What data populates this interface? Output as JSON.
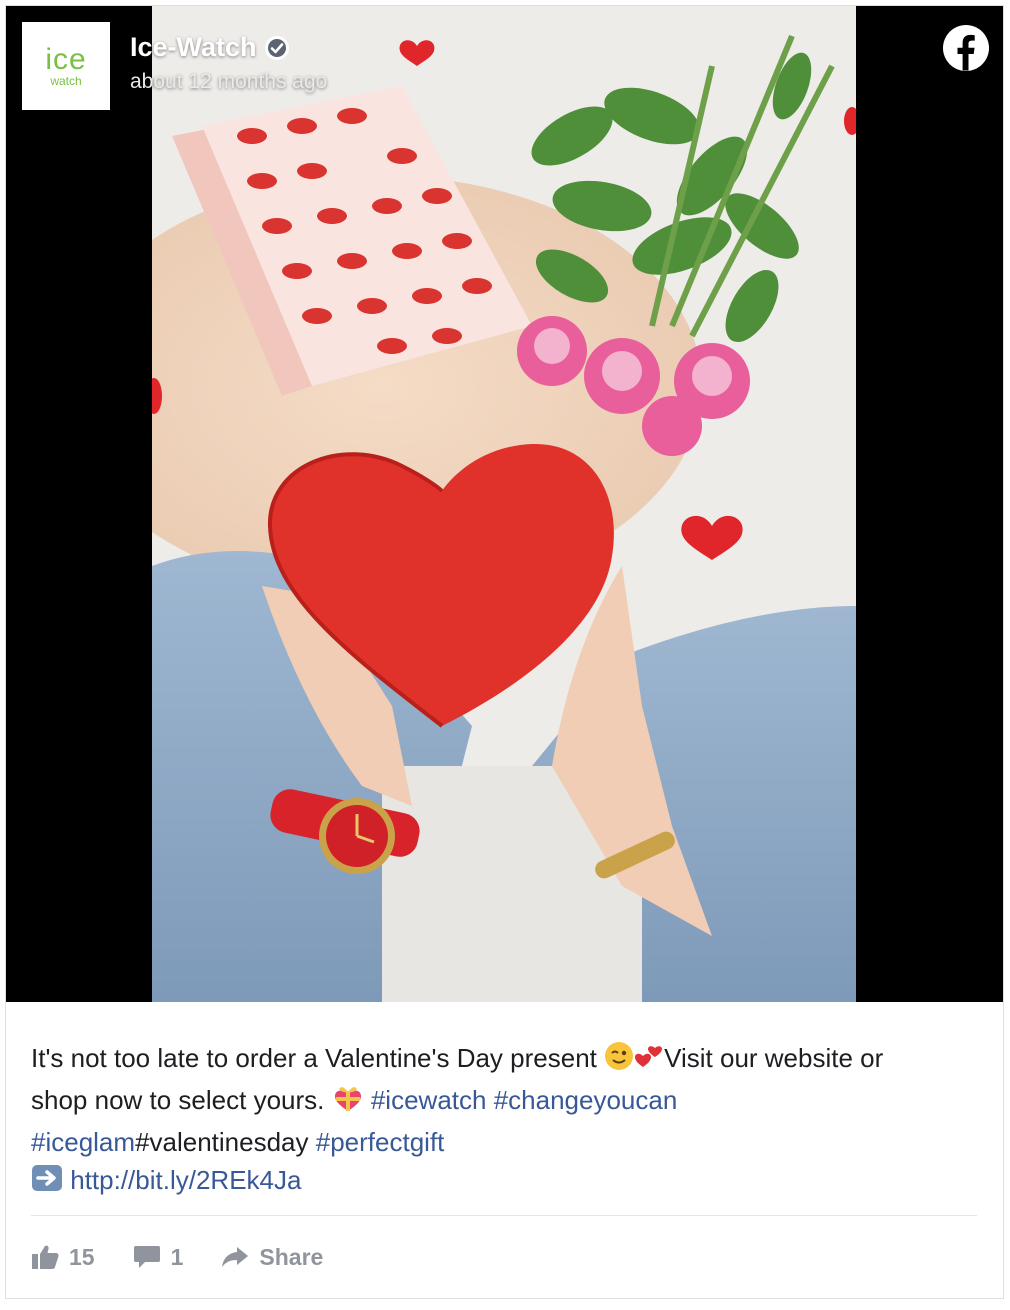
{
  "header": {
    "logo_text_top": "ice",
    "logo_text_bottom": "watch",
    "author": "Ice-Watch",
    "timestamp": "about 12 months ago"
  },
  "icons": {
    "verified": "verified-badge-icon",
    "platform": "facebook-icon",
    "like": "thumbs-up-icon",
    "comment": "comment-icon",
    "share": "share-arrow-icon",
    "arrow": "right-arrow-emoji-icon"
  },
  "post": {
    "line1_text": "It's not too late to order a Valentine's Day present ",
    "line1_after": "Visit our website or",
    "line2_text": "shop now to select yours. ",
    "tag_icewatch": "#icewatch",
    "tag_changeyoucan": "#changeyoucan",
    "tag_iceglam": "#iceglam",
    "tag_valentinesday": "#valentinesday",
    "tag_perfectgift": "#perfectgift",
    "link": "http://bit.ly/2REk4Ja"
  },
  "stats": {
    "likes": "15",
    "comments": "1",
    "share_label": "Share"
  },
  "colors": {
    "brand_green": "#7ac143",
    "link_blue": "#385898",
    "action_gray": "#90949c"
  }
}
